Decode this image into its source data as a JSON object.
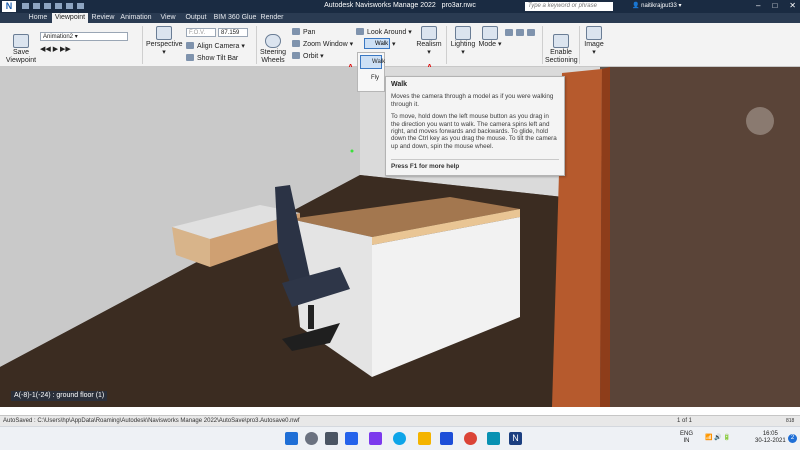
{
  "window": {
    "app_logo": "N",
    "title": "Autodesk Navisworks Manage 2022",
    "file": "pro3ar.nwc",
    "search_placeholder": "Type a keyword or phrase",
    "user": "naitikrajput33",
    "min_glyph": "–",
    "max_glyph": "□",
    "close_glyph": "✕"
  },
  "tabs": [
    "Home",
    "Viewpoint",
    "Review",
    "Animation",
    "View",
    "Output",
    "BIM 360 Glue",
    "Render"
  ],
  "active_tab": "Viewpoint",
  "ribbon": {
    "save_viewpoint": "Save\nViewpoint",
    "animation_combo": "Animation2",
    "fov_label": "F.O.V.",
    "fov_value": "87.159",
    "perspective": "Perspective",
    "align_camera": "Align Camera",
    "show_tilt_bar": "Show Tilt Bar",
    "steering_wheels": "Steering\nWheels",
    "pan": "Pan",
    "zoom_window": "Zoom Window",
    "orbit": "Orbit",
    "look_around": "Look Around",
    "walk": "Walk",
    "realism": "Realism",
    "lighting": "Lighting",
    "mode": "Mode",
    "enable_sectioning": "Enable\nSectioning",
    "image": "Image",
    "marker_a": "A"
  },
  "dropdown": {
    "items": [
      "Walk",
      "Fly"
    ]
  },
  "tooltip": {
    "title": "Walk",
    "line1": "Moves the camera through a model as if you were walking through it.",
    "line2": "To move, hold down the left mouse button as you drag in the direction you want to walk. The camera spins left and right, and moves forwards and backwards. To glide, hold down the Ctrl key as you drag the mouse. To tilt the camera up and down, spin the mouse wheel.",
    "help": "Press F1 for more help"
  },
  "viewport": {
    "location_label": "A(-8)-1(-24) : ground floor (1)",
    "colors": {
      "wall": "#d9d9d9",
      "floor": "#3a2c22",
      "desk_top": "#a3774f",
      "door": "#b4562b"
    }
  },
  "statusbar": {
    "autosave": "AutoSaved : C:\\Users\\hp\\AppData\\Roaming\\Autodesk\\Navisworks Manage 2022\\AutoSave\\pro3.Autosave0.nwf",
    "page": "1 of 1",
    "mem": "818"
  },
  "taskbar": {
    "lang1": "ENG",
    "lang2": "IN",
    "time": "16:05",
    "date": "30-12-2021",
    "notif": "2"
  }
}
